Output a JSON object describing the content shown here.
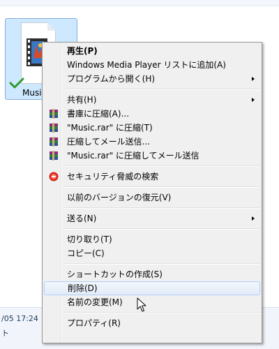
{
  "explorer": {
    "file_label": "Music",
    "status_date": "/05 17:24",
    "status_text": "ト"
  },
  "context_menu": {
    "items": [
      {
        "label": "再生(P)"
      },
      {
        "label": "Windows Media Player リストに追加(A)"
      },
      {
        "label": "プログラムから開く(H)"
      },
      {
        "label": "共有(H)"
      },
      {
        "label": "書庫に圧縮(A)..."
      },
      {
        "label": "\"Music.rar\" に圧縮(T)"
      },
      {
        "label": "圧縮してメール送信..."
      },
      {
        "label": "\"Music.rar\" に圧縮してメール送信"
      },
      {
        "label": "セキュリティ脅威の検索"
      },
      {
        "label": "以前のバージョンの復元(V)"
      },
      {
        "label": "送る(N)"
      },
      {
        "label": "切り取り(T)"
      },
      {
        "label": "コピー(C)"
      },
      {
        "label": "ショートカットの作成(S)"
      },
      {
        "label": "削除(D)"
      },
      {
        "label": "名前の変更(M)"
      },
      {
        "label": "プロパティ(R)"
      }
    ]
  },
  "colors": {
    "menu_background": "#f0f0f0",
    "hover_border": "#aecff7",
    "selection_tile": "#cde8ff"
  },
  "icons": {
    "file": "media-file-icon",
    "sync_state": "check-icon",
    "archive": "winrar-books-icon",
    "security": "security-scan-icon",
    "pointer": "mouse-cursor-icon"
  }
}
